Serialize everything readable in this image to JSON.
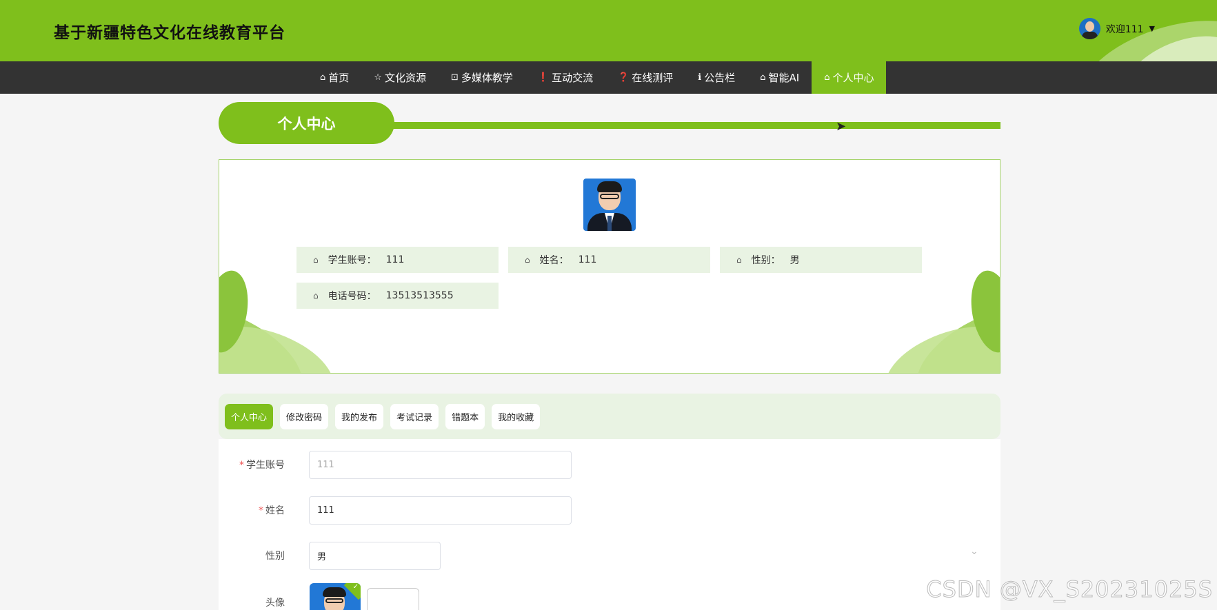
{
  "header": {
    "site_title": "基于新疆特色文化在线教育平台",
    "welcome": "欢迎111",
    "caret": "▼"
  },
  "nav": {
    "items": [
      {
        "icon": "⌂",
        "label": "首页"
      },
      {
        "icon": "☆",
        "label": "文化资源"
      },
      {
        "icon": "⊡",
        "label": "多媒体教学"
      },
      {
        "icon": "❗",
        "label": "互动交流"
      },
      {
        "icon": "❓",
        "label": "在线测评"
      },
      {
        "icon": "ℹ",
        "label": "公告栏"
      },
      {
        "icon": "⌂",
        "label": "智能AI"
      },
      {
        "icon": "⌂",
        "label": "个人中心"
      }
    ],
    "active_index": 7
  },
  "section": {
    "title": "个人中心"
  },
  "profile": {
    "fields": [
      {
        "icon": "⌂",
        "label": "学生账号：",
        "value": "111"
      },
      {
        "icon": "⌂",
        "label": "姓名：",
        "value": "111"
      },
      {
        "icon": "⌂",
        "label": "性别：",
        "value": "男"
      },
      {
        "icon": "⌂",
        "label": "电话号码：",
        "value": "13513513555"
      }
    ]
  },
  "tabs": {
    "items": [
      "个人中心",
      "修改密码",
      "我的发布",
      "考试记录",
      "错题本",
      "我的收藏"
    ],
    "active_index": 0
  },
  "form": {
    "account": {
      "required_mark": "*",
      "label": "学生账号",
      "value": "111"
    },
    "name": {
      "required_mark": "*",
      "label": "姓名",
      "value": "111"
    },
    "gender": {
      "label": "性别",
      "value": "男",
      "chevron": "⌄"
    },
    "avatar": {
      "label": "头像",
      "check": "✓",
      "add": "+"
    }
  },
  "watermark": "CSDN @VX_S20231025S",
  "colors": {
    "accent": "#7fbf1c",
    "nav_bg": "#333333",
    "info_bg": "#e9f3e3"
  }
}
